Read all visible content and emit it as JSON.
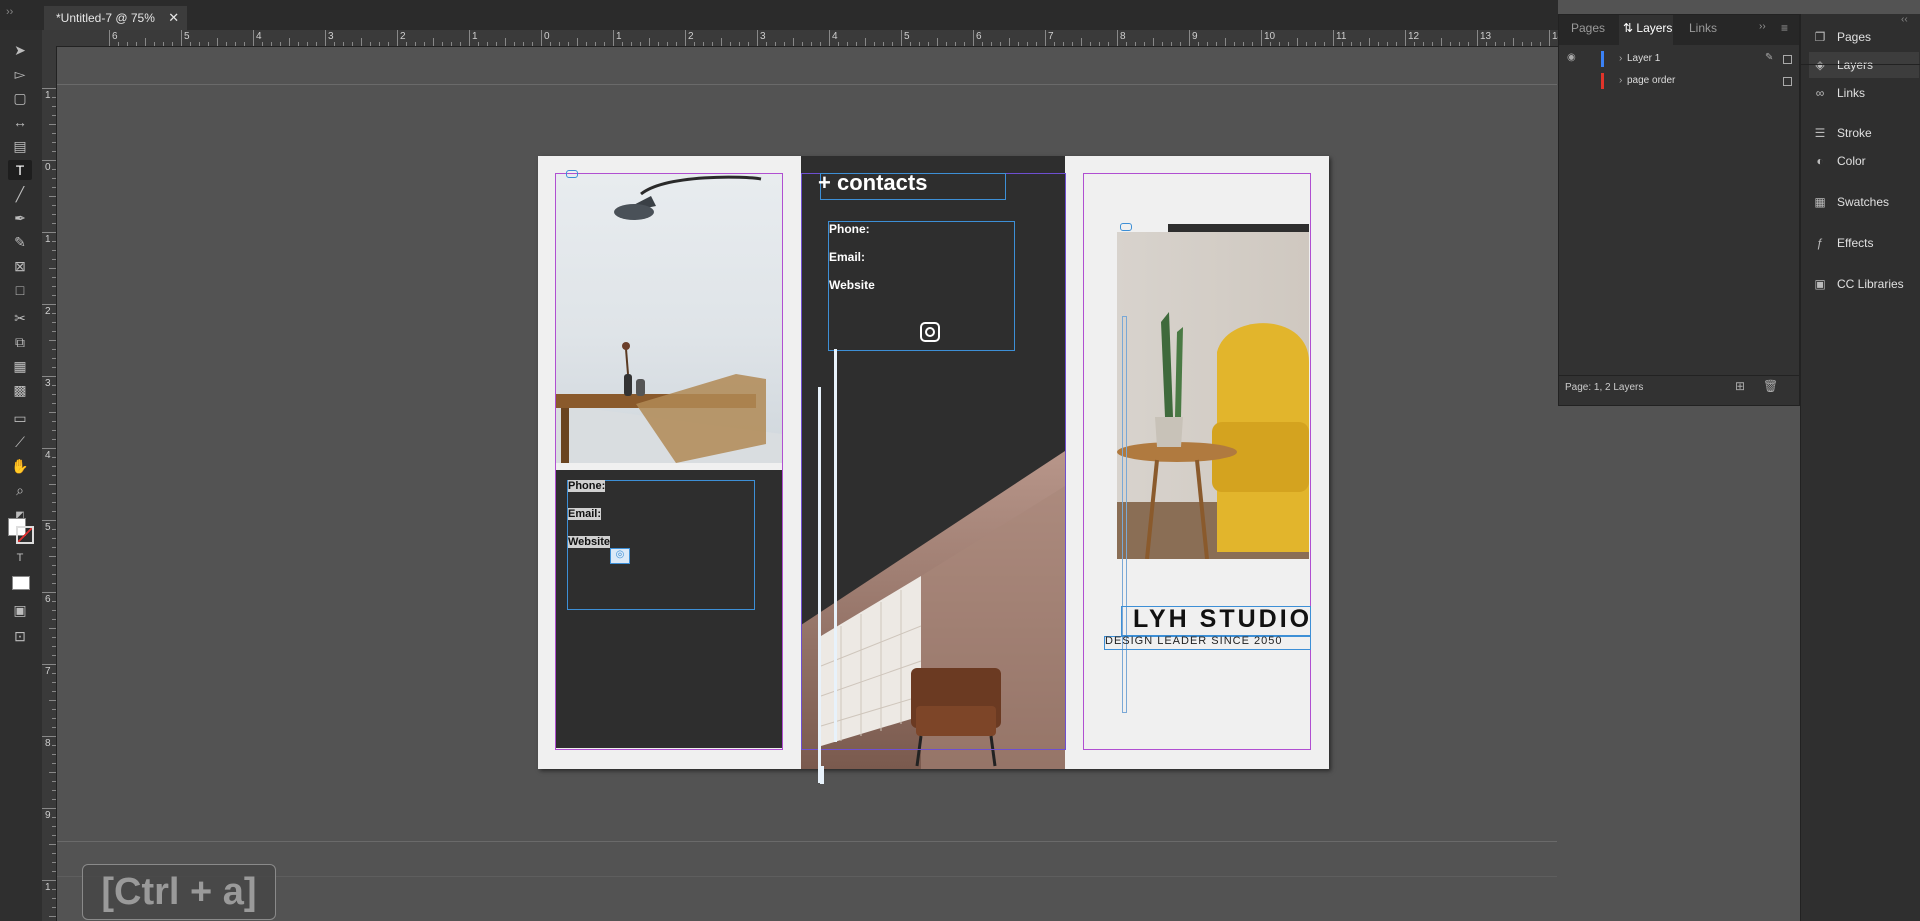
{
  "document_tab": {
    "title": "*Untitled-7 @ 75%",
    "close": "✕"
  },
  "ruler": {
    "horizontal_labels": [
      "6",
      "5",
      "4",
      "3",
      "2",
      "1",
      "0",
      "1",
      "2",
      "3",
      "4",
      "5",
      "6",
      "7",
      "8",
      "9",
      "10",
      "11",
      "12",
      "13",
      "14"
    ],
    "vertical_labels": [
      "1",
      "0",
      "1",
      "2",
      "3",
      "4",
      "5",
      "6",
      "7",
      "8",
      "9",
      "1"
    ]
  },
  "layers_panel": {
    "tabs": [
      "Pages",
      "Layers",
      "Links"
    ],
    "active_tab": "Layers",
    "layers": [
      {
        "name": "Layer 1",
        "color": "#3b82f6"
      },
      {
        "name": "page order",
        "color": "#e0342a"
      }
    ],
    "status": "Page: 1, 2 Layers"
  },
  "right_dock": {
    "items": [
      {
        "label": "Pages",
        "icon": "pages-icon"
      },
      {
        "label": "Layers",
        "icon": "layers-icon"
      },
      {
        "label": "Links",
        "icon": "links-icon"
      },
      {
        "label": "Stroke",
        "icon": "stroke-icon"
      },
      {
        "label": "Color",
        "icon": "color-icon"
      },
      {
        "label": "Swatches",
        "icon": "swatches-icon"
      },
      {
        "label": "Effects",
        "icon": "effects-icon"
      },
      {
        "label": "CC Libraries",
        "icon": "cc-libraries-icon"
      }
    ]
  },
  "spread": {
    "left_contact": {
      "phone": "Phone:",
      "email": "Email:",
      "website": "Website"
    },
    "center": {
      "heading": "+ contacts",
      "phone": "Phone:",
      "email": "Email:",
      "website": "Website"
    },
    "right": {
      "studio": "LYH STUDIO",
      "tagline": "DESIGN LEADER SINCE 2050"
    }
  },
  "shortcut_overlay": "[Ctrl + a]",
  "colors": {
    "accent": "#3b82f6",
    "margin_guides": "#b04fd1",
    "dark_panel": "#2e2e2e"
  }
}
